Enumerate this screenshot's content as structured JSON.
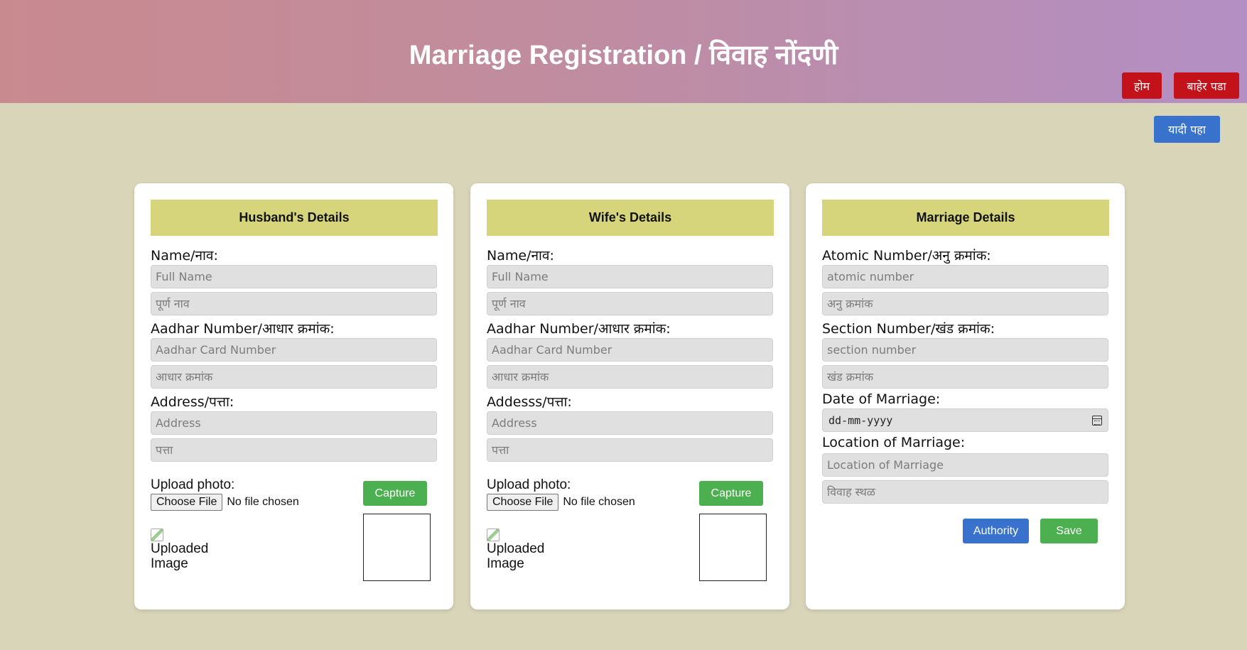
{
  "header": {
    "title": "Marriage Registration / विवाह नोंदणी",
    "home_label": "होम",
    "exit_label": "बाहेर पडा",
    "list_label": "यादी पहा"
  },
  "husband": {
    "heading": "Husband's Details",
    "name_label": "Name/नाव:",
    "name_placeholder": "Full Name",
    "name_mr_placeholder": "पूर्ण नाव",
    "aadhar_label": "Aadhar Number/आधार क्रमांक:",
    "aadhar_placeholder": "Aadhar Card Number",
    "aadhar_mr_placeholder": "आधार क्रमांक",
    "address_label": "Address/पत्ता:",
    "address_placeholder": "Address",
    "address_mr_placeholder": "पत्ता",
    "upload_label": "Upload photo:",
    "choose_file_label": "Choose File",
    "no_file_label": "No file chosen",
    "capture_label": "Capture",
    "uploaded_alt": "Uploaded Image"
  },
  "wife": {
    "heading": "Wife's Details",
    "name_label": "Name/नाव:",
    "name_placeholder": "Full Name",
    "name_mr_placeholder": "पूर्ण नाव",
    "aadhar_label": "Aadhar Number/आधार क्रमांक:",
    "aadhar_placeholder": "Aadhar Card Number",
    "aadhar_mr_placeholder": "आधार क्रमांक",
    "address_label": "Addesss/पत्ता:",
    "address_placeholder": "Address",
    "address_mr_placeholder": "पत्ता",
    "upload_label": "Upload photo:",
    "choose_file_label": "Choose File",
    "no_file_label": "No file chosen",
    "capture_label": "Capture",
    "uploaded_alt": "Uploaded Image"
  },
  "marriage": {
    "heading": "Marriage Details",
    "atomic_label": "Atomic Number/अनु क्रमांक:",
    "atomic_placeholder": "atomic number",
    "atomic_mr_placeholder": "अनु क्रमांक",
    "section_label": "Section Number/खंड क्रमांक:",
    "section_placeholder": "section number",
    "section_mr_placeholder": "खंड क्रमांक",
    "date_label": "Date of Marriage:",
    "date_placeholder": "dd-mm-yyyy",
    "location_label": "Location of Marriage:",
    "location_placeholder": "Location of Marriage",
    "location_mr_placeholder": "विवाह स्थळ",
    "authority_label": "Authority",
    "save_label": "Save"
  },
  "colors": {
    "accent_red": "#c4121a",
    "accent_blue": "#3872cc",
    "accent_green": "#4caf50",
    "card_heading_bg": "#d7d57c",
    "page_bg": "#d9d5b9"
  }
}
